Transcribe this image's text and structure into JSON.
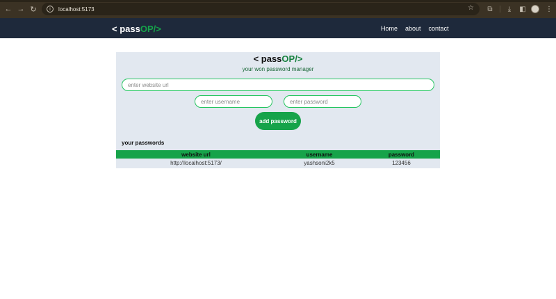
{
  "browser": {
    "url": "localhost:5173"
  },
  "navbar": {
    "logo": {
      "prefix": "< pass",
      "accent": "OP/>"
    },
    "links": [
      "Home",
      "about",
      "contact"
    ]
  },
  "card": {
    "title": {
      "prefix": "< pass",
      "accent": "OP/>"
    },
    "subtitle": "your won password manager",
    "url_placeholder": "enter website url",
    "username_placeholder": "enter username",
    "password_placeholder": "enter password",
    "add_button": "add password",
    "section_title": "your passwords",
    "table": {
      "headers": [
        "website url",
        "username",
        "password"
      ],
      "rows": [
        [
          "http://localhost:5173/",
          "yashsoni2k5",
          "123456"
        ]
      ]
    }
  },
  "colors": {
    "accent_green": "#16a34a",
    "navbar_bg": "#1e293b",
    "card_bg": "#e2e8f0"
  }
}
